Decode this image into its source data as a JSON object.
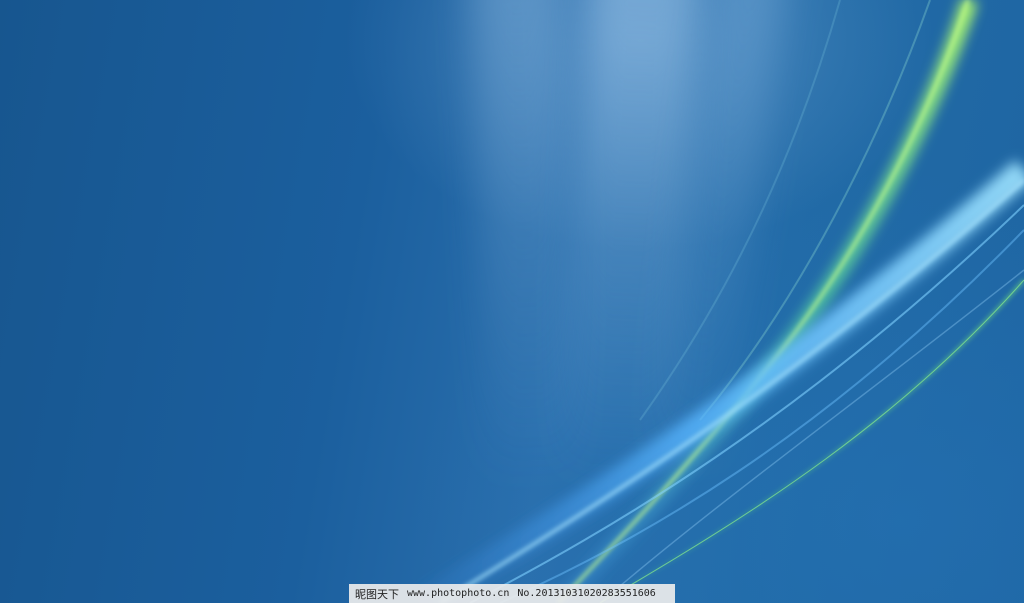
{
  "wallpaper": {
    "colors": {
      "base": "#1b5e9c",
      "highlight": "#9cc6ea",
      "ribbon_blue": "#6fd0ff",
      "ribbon_green": "#7df07a"
    }
  },
  "watermark": {
    "brand": "昵图天下",
    "url": "www.photophoto.cn",
    "number": "No.20131031020283551606"
  }
}
